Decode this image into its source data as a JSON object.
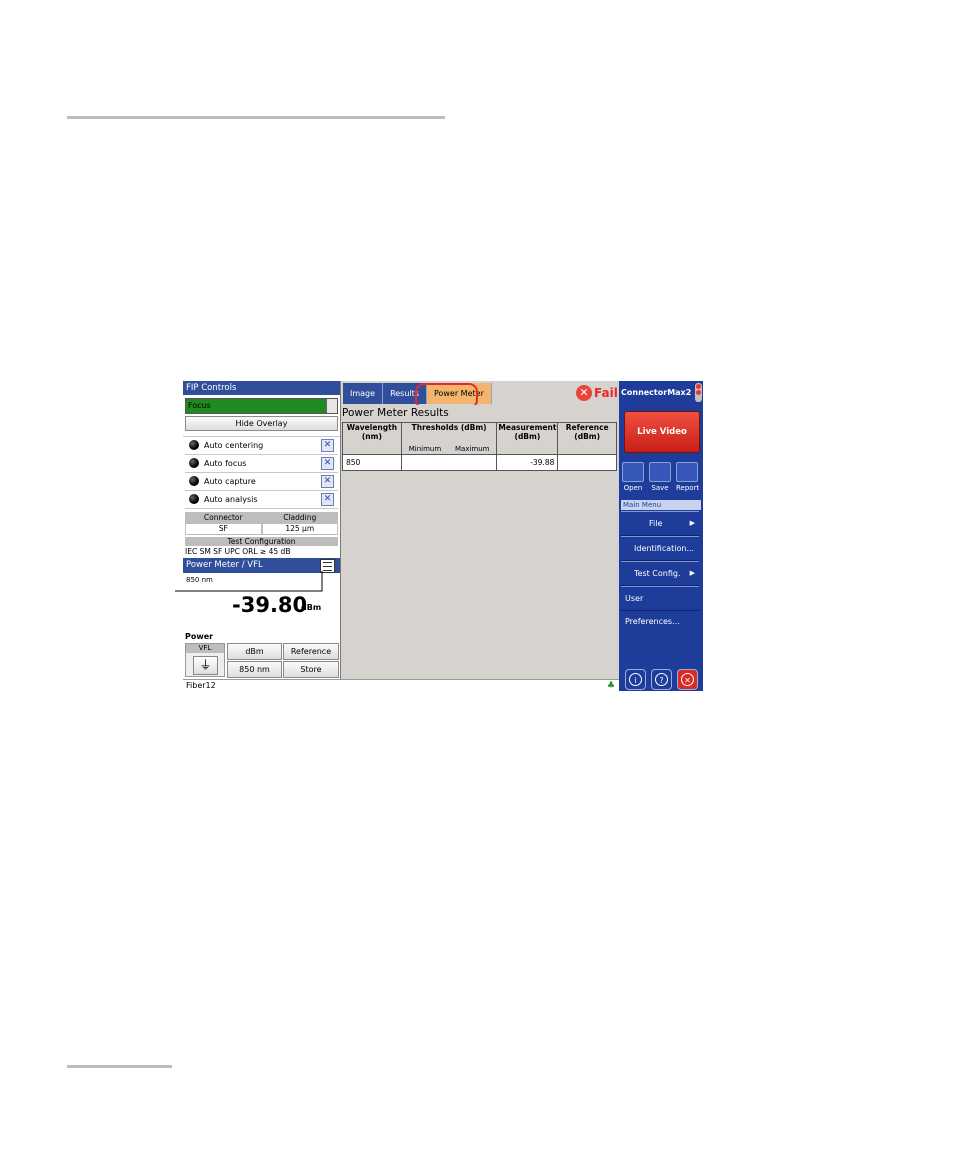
{
  "fip_controls": {
    "title": "FIP Controls",
    "focus_label": "Focus",
    "hide_overlay_label": "Hide Overlay",
    "options": [
      "Auto centering",
      "Auto focus",
      "Auto capture",
      "Auto analysis"
    ],
    "connector_header": "Connector",
    "cladding_header": "Cladding",
    "connector_value": "SF",
    "cladding_value": "125 µm",
    "test_config_header": "Test Configuration",
    "test_config_value": "IEC SM SF UPC ORL ≥ 45 dB"
  },
  "power_meter": {
    "title": "Power Meter / VFL",
    "wavelength": "850 nm",
    "value": "-39.80",
    "unit": "dBm",
    "power_label": "Power",
    "vfl_label": "VFL",
    "unit_button": "dBm",
    "reference_button": "Reference",
    "wavelength_button": "850 nm",
    "store_button": "Store"
  },
  "tabs": [
    "Image",
    "Results",
    "Power Meter"
  ],
  "status_text": "Fail",
  "results": {
    "title": "Power Meter Results",
    "headers": {
      "wavelength": "Wavelength (nm)",
      "thresholds": "Thresholds (dBm)",
      "min": "Minimum",
      "max": "Maximum",
      "measurement": "Measurement (dBm)",
      "reference": "Reference (dBm)"
    },
    "rows": [
      {
        "wavelength": "850",
        "min": "",
        "max": "",
        "measurement": "-39.88",
        "reference": ""
      }
    ]
  },
  "right_panel": {
    "app_title": "ConnectorMax2",
    "live_video": "Live Video",
    "open": "Open",
    "save": "Save",
    "report": "Report",
    "main_menu": "Main Menu",
    "menu": [
      "File",
      "Identification...",
      "Test Config.",
      "User Preferences..."
    ]
  },
  "footer": {
    "fiber": "Fiber12"
  },
  "colors": {
    "titlebar": "#2f4f9b",
    "active_tab": "#f3b56b",
    "fail": "#e8282a",
    "live_video": "#d9261c"
  }
}
